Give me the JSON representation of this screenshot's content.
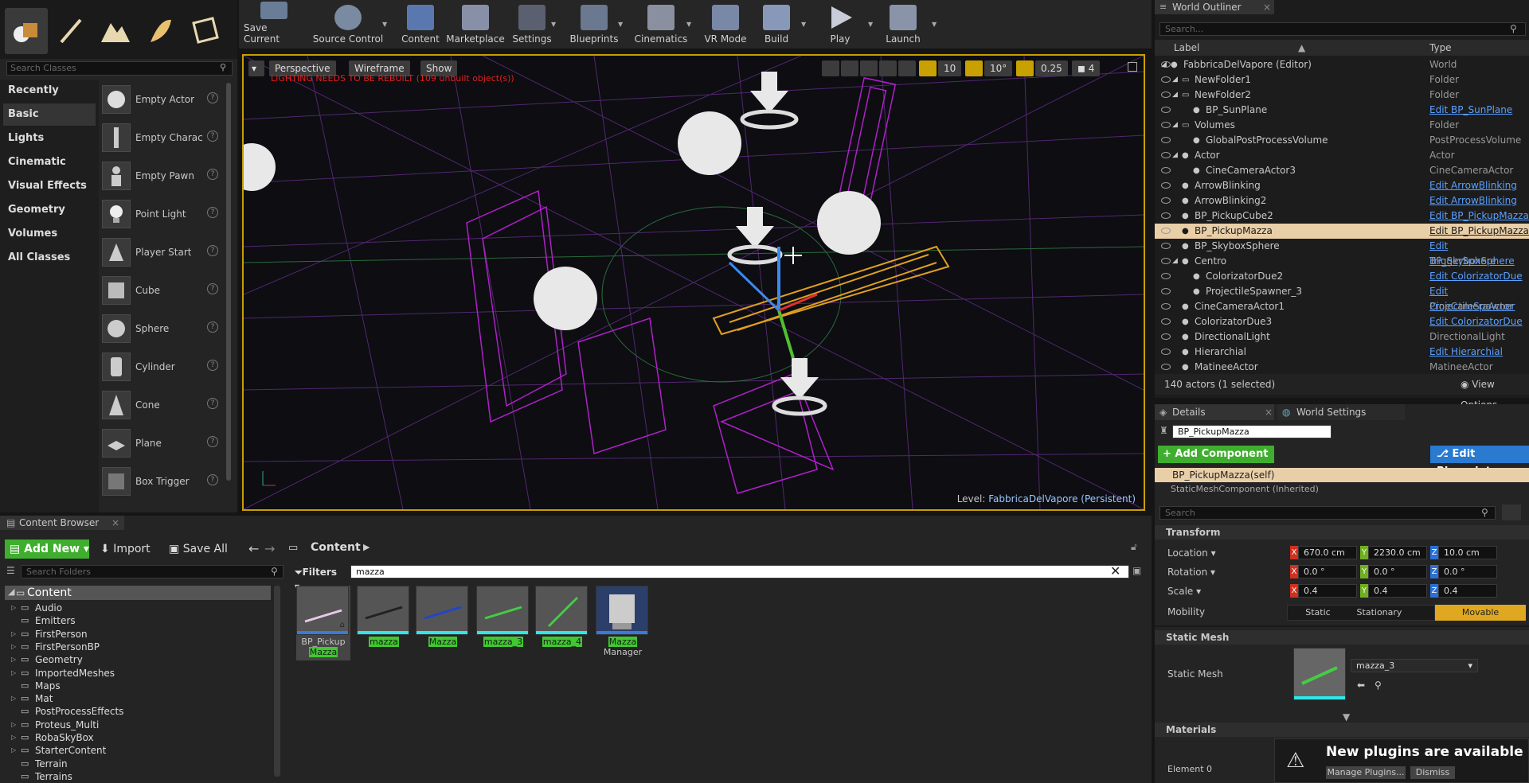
{
  "toolbar": {
    "buttons": [
      {
        "label": "Save Current",
        "icon": "save-icon"
      },
      {
        "label": "Source Control",
        "icon": "source-control-icon"
      },
      {
        "label": "Content",
        "icon": "content-icon"
      },
      {
        "label": "Marketplace",
        "icon": "marketplace-icon"
      },
      {
        "label": "Settings",
        "icon": "settings-icon"
      },
      {
        "label": "Blueprints",
        "icon": "blueprints-icon"
      },
      {
        "label": "Cinematics",
        "icon": "cinematics-icon"
      },
      {
        "label": "VR Mode",
        "icon": "vr-mode-icon"
      },
      {
        "label": "Build",
        "icon": "build-icon"
      },
      {
        "label": "Play",
        "icon": "play-icon"
      },
      {
        "label": "Launch",
        "icon": "launch-icon"
      }
    ]
  },
  "place": {
    "search_placeholder": "Search Classes",
    "categories": [
      "Recently Placed",
      "Basic",
      "Lights",
      "Cinematic",
      "Visual Effects",
      "Geometry",
      "Volumes",
      "All Classes"
    ],
    "items": [
      "Empty Actor",
      "Empty Charac",
      "Empty Pawn",
      "Point Light",
      "Player Start",
      "Cube",
      "Sphere",
      "Cylinder",
      "Cone",
      "Plane",
      "Box Trigger"
    ]
  },
  "viewport": {
    "perspective": "Perspective",
    "wireframe": "Wireframe",
    "show": "Show",
    "warning": "LIGHTING NEEDS TO BE REBUILT (109 unbuilt object(s))",
    "grid_snap": "10",
    "rot_snap": "10°",
    "scale_snap": "0.25",
    "camera_speed": "4",
    "level_label": "Level:",
    "level_name": "FabbricaDelVapore (Persistent)"
  },
  "outliner": {
    "tab": "World Outliner",
    "search_placeholder": "Search...",
    "col_label": "Label",
    "col_type": "Type",
    "rows": [
      {
        "label": "FabbricaDelVapore (Editor)",
        "type": "World",
        "link": false
      },
      {
        "label": "NewFolder1",
        "type": "Folder",
        "link": false
      },
      {
        "label": "NewFolder2",
        "type": "Folder",
        "link": false
      },
      {
        "label": "BP_SunPlane",
        "type": "Edit BP_SunPlane",
        "link": true
      },
      {
        "label": "Volumes",
        "type": "Folder",
        "link": false
      },
      {
        "label": "GlobalPostProcessVolume",
        "type": "PostProcessVolume",
        "link": false
      },
      {
        "label": "Actor",
        "type": "Actor",
        "link": false
      },
      {
        "label": "CineCameraActor3",
        "type": "CineCameraActor",
        "link": false
      },
      {
        "label": "ArrowBlinking",
        "type": "Edit ArrowBlinking",
        "link": true
      },
      {
        "label": "ArrowBlinking2",
        "type": "Edit ArrowBlinking",
        "link": true
      },
      {
        "label": "BP_PickupCube2",
        "type": "Edit BP_PickupMazza",
        "link": true
      },
      {
        "label": "BP_PickupMazza",
        "type": "Edit BP_PickupMazza",
        "link": true
      },
      {
        "label": "BP_SkyboxSphere",
        "type": "Edit BP_SkyboxSphere",
        "link": true
      },
      {
        "label": "Centro",
        "type": "TriggerSphere",
        "link": false
      },
      {
        "label": "ColorizatorDue2",
        "type": "Edit ColorizatorDue",
        "link": true
      },
      {
        "label": "ProjectileSpawner_3",
        "type": "Edit ProjectileSpawner",
        "link": true
      },
      {
        "label": "CineCameraActor1",
        "type": "CineCameraActor",
        "link": false
      },
      {
        "label": "ColorizatorDue3",
        "type": "Edit ColorizatorDue",
        "link": true
      },
      {
        "label": "DirectionalLight",
        "type": "DirectionalLight",
        "link": false
      },
      {
        "label": "Hierarchial",
        "type": "Edit Hierarchial",
        "link": true
      },
      {
        "label": "MatineeActor",
        "type": "MatineeActor",
        "link": false
      }
    ],
    "status": "140 actors (1 selected)",
    "view_options": "View Options"
  },
  "details": {
    "tab_details": "Details",
    "tab_world": "World Settings",
    "actor_name": "BP_PickupMazza",
    "add_component": "+ Add Component",
    "edit_blueprint": "Edit Blueprint",
    "self_label": "BP_PickupMazza(self)",
    "inherited": "StaticMeshComponent (Inherited)",
    "search_placeholder": "Search",
    "transform": "Transform",
    "location_label": "Location",
    "rotation_label": "Rotation",
    "scale_label": "Scale",
    "mobility_label": "Mobility",
    "location": [
      "670.0 cm",
      "2230.0 cm",
      "10.0 cm"
    ],
    "rotation": [
      "0.0 °",
      "0.0 °",
      "0.0 °"
    ],
    "scale": [
      "0.4",
      "0.4",
      "0.4"
    ],
    "axes": [
      "X",
      "Y",
      "Z"
    ],
    "mobility": [
      "Static",
      "Stationary",
      "Movable"
    ],
    "static_mesh_section": "Static Mesh",
    "static_mesh_label": "Static Mesh",
    "static_mesh_value": "mazza_3",
    "materials": "Materials",
    "element0": "Element 0",
    "notice_title": "New plugins are available",
    "manage_plugins": "Manage Plugins...",
    "dismiss": "Dismiss"
  },
  "content_browser": {
    "tab": "Content Browser",
    "add_new": "Add New",
    "import": "Import",
    "save_all": "Save All",
    "path": "Content",
    "search_folders": "Search Folders",
    "filters": "Filters",
    "search_value": "mazza",
    "root": "Content",
    "folders": [
      "Audio",
      "Emitters",
      "FirstPerson",
      "FirstPersonBP",
      "Geometry",
      "ImportedMeshes",
      "Maps",
      "Mat",
      "PostProcessEffects",
      "Proteus_Multi",
      "RobaSkyBox",
      "StarterContent",
      "Terrain",
      "Terrains"
    ],
    "assets": [
      {
        "line1": "BP_Pickup",
        "line2": "Mazza"
      },
      {
        "line1": "mazza",
        "line2": ""
      },
      {
        "line1": "Mazza",
        "line2": ""
      },
      {
        "line1": "mazza_3",
        "line2": ""
      },
      {
        "line1": "mazza_4",
        "line2": ""
      },
      {
        "line1": "Mazza",
        "line2": "Manager"
      }
    ]
  },
  "colors": {
    "accent_green": "#3fc92f",
    "selection": "#e9cfa8",
    "viewport_border": "#c8a000",
    "link": "#5aa0ff",
    "warning_red": "#e02020",
    "wire_magenta": "#b020c8",
    "wire_yellow": "#e0a020"
  }
}
